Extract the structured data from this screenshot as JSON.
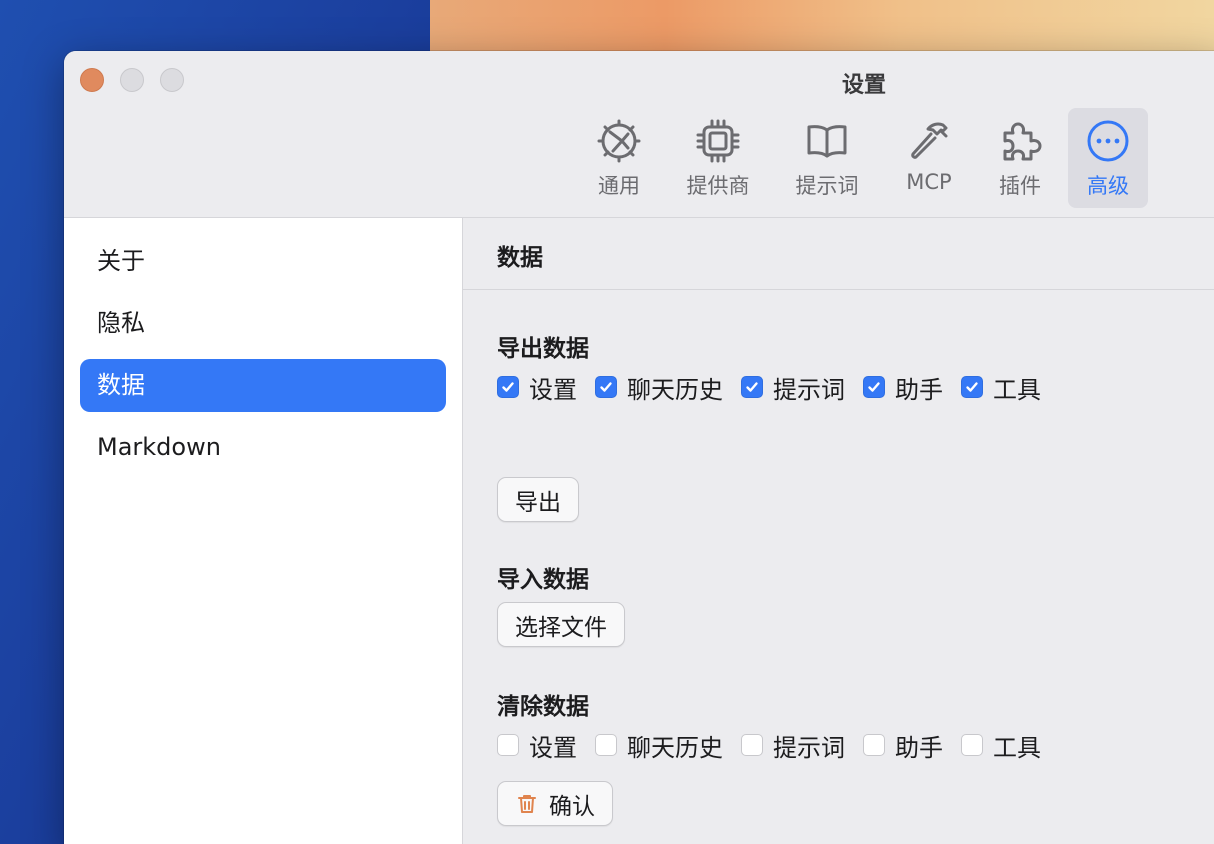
{
  "window": {
    "title": "设置"
  },
  "toolbar": {
    "items": [
      {
        "label": "通用",
        "icon": "aperture-gear-icon",
        "active": false
      },
      {
        "label": "提供商",
        "icon": "chip-icon",
        "active": false
      },
      {
        "label": "提示词",
        "icon": "book-icon",
        "active": false
      },
      {
        "label": "MCP",
        "icon": "hammer-icon",
        "active": false
      },
      {
        "label": "插件",
        "icon": "puzzle-icon",
        "active": false
      },
      {
        "label": "高级",
        "icon": "ellipsis-circle-icon",
        "active": true
      }
    ]
  },
  "sidebar": {
    "items": [
      {
        "label": "关于",
        "active": false
      },
      {
        "label": "隐私",
        "active": false
      },
      {
        "label": "数据",
        "active": true
      },
      {
        "label": "Markdown",
        "active": false
      }
    ]
  },
  "content": {
    "title": "数据",
    "export": {
      "title": "导出数据",
      "options": [
        {
          "label": "设置",
          "checked": true
        },
        {
          "label": "聊天历史",
          "checked": true
        },
        {
          "label": "提示词",
          "checked": true
        },
        {
          "label": "助手",
          "checked": true
        },
        {
          "label": "工具",
          "checked": true
        }
      ],
      "button_label": "导出"
    },
    "import": {
      "title": "导入数据",
      "button_label": "选择文件"
    },
    "clear": {
      "title": "清除数据",
      "options": [
        {
          "label": "设置",
          "checked": false
        },
        {
          "label": "聊天历史",
          "checked": false
        },
        {
          "label": "提示词",
          "checked": false
        },
        {
          "label": "助手",
          "checked": false
        },
        {
          "label": "工具",
          "checked": false
        }
      ],
      "button_label": "确认",
      "button_icon": "trash-icon"
    }
  },
  "colors": {
    "accent": "#3478f6",
    "close_button": "#e08a5e",
    "trash_icon": "#e0844e"
  }
}
